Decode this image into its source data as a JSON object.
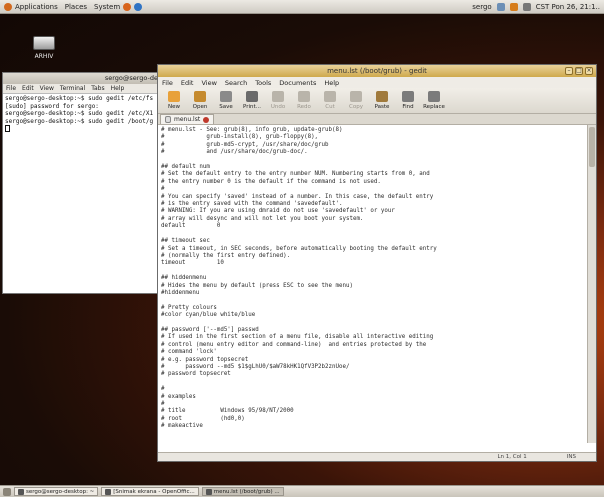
{
  "top_panel": {
    "applications": "Applications",
    "places": "Places",
    "system": "System",
    "user": "sergo",
    "datetime": "CST Pon 26, 21:1..",
    "colors": {
      "firefox": "#d8641c",
      "help": "#2f73c4"
    }
  },
  "desktop": {
    "icon_label": "ARHIV"
  },
  "terminal": {
    "title": "sergo@sergo-de",
    "menu": [
      "File",
      "Edit",
      "View",
      "Terminal",
      "Tabs",
      "Help"
    ],
    "lines": [
      "sergo@sergo-desktop:~$ sudo gedit /etc/fs",
      "[sudo] password for sergo:",
      "sergo@sergo-desktop:~$ sudo gedit /etc/X1",
      "sergo@sergo-desktop:~$ sudo gedit /boot/g"
    ]
  },
  "gedit": {
    "title": "menu.lst (/boot/grub) - gedit",
    "menu": [
      "File",
      "Edit",
      "View",
      "Search",
      "Tools",
      "Documents",
      "Help"
    ],
    "toolbar": [
      {
        "label": "New",
        "icon": "new-icon",
        "disabled": false,
        "color": "#e8a13a"
      },
      {
        "label": "Open",
        "icon": "open-icon",
        "disabled": false,
        "color": "#c58a2e"
      },
      {
        "label": "Save",
        "icon": "save-icon",
        "disabled": false,
        "color": "#8a8a8a"
      },
      {
        "label": "Print...",
        "icon": "print-icon",
        "disabled": false,
        "color": "#6a6a6a"
      },
      {
        "label": "Undo",
        "icon": "undo-icon",
        "disabled": true,
        "color": "#b9b4aa"
      },
      {
        "label": "Redo",
        "icon": "redo-icon",
        "disabled": true,
        "color": "#b9b4aa"
      },
      {
        "label": "Cut",
        "icon": "cut-icon",
        "disabled": true,
        "color": "#b9b4aa"
      },
      {
        "label": "Copy",
        "icon": "copy-icon",
        "disabled": true,
        "color": "#b9b4aa"
      },
      {
        "label": "Paste",
        "icon": "paste-icon",
        "disabled": false,
        "color": "#a07a3c"
      },
      {
        "label": "Find",
        "icon": "find-icon",
        "disabled": false,
        "color": "#7b7b7b"
      },
      {
        "label": "Replace",
        "icon": "replace-icon",
        "disabled": false,
        "color": "#7b7b7b"
      }
    ],
    "tab_label": "menu.lst",
    "editor_lines": [
      "# menu.lst - See: grub(8), info grub, update-grub(8)",
      "#            grub-install(8), grub-floppy(8),",
      "#            grub-md5-crypt, /usr/share/doc/grub",
      "#            and /usr/share/doc/grub-doc/.",
      "",
      "## default num",
      "# Set the default entry to the entry number NUM. Numbering starts from 0, and",
      "# the entry number 0 is the default if the command is not used.",
      "#",
      "# You can specify 'saved' instead of a number. In this case, the default entry",
      "# is the entry saved with the command 'savedefault'.",
      "# WARNING: If you are using dmraid do not use 'savedefault' or your",
      "# array will desync and will not let you boot your system.",
      "default         0",
      "",
      "## timeout sec",
      "# Set a timeout, in SEC seconds, before automatically booting the default entry",
      "# (normally the first entry defined).",
      "timeout         10",
      "",
      "## hiddenmenu",
      "# Hides the menu by default (press ESC to see the menu)",
      "#hiddenmenu",
      "",
      "# Pretty colours",
      "#color cyan/blue white/blue",
      "",
      "## password ['--md5'] passwd",
      "# If used in the first section of a menu file, disable all interactive editing",
      "# control (menu entry editor and command-line)  and entries protected by the",
      "# command 'lock'",
      "# e.g. password topsecret",
      "#      password --md5 $1$gLhU0/$aW78kHK1QfV3P2b2znUoe/",
      "# password topsecret",
      "",
      "#",
      "# examples",
      "#",
      "# title          Windows 95/98/NT/2000",
      "# root           (hd0,0)",
      "# makeactive"
    ],
    "status_position": "Ln 1, Col 1",
    "status_mode": "INS"
  },
  "taskbar": {
    "items": [
      {
        "label": "sergo@sergo-desktop: ~",
        "active": false
      },
      {
        "label": "[Snimak ekrana - OpenOffic...",
        "active": false
      },
      {
        "label": "menu.lst (/boot/grub) ...",
        "active": true
      }
    ]
  }
}
